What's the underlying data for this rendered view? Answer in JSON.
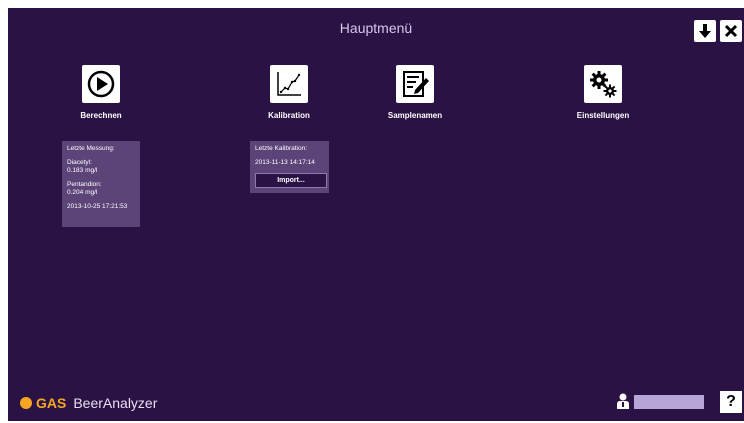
{
  "header": {
    "title": "Hauptmenü",
    "download_icon": "download-arrow-icon",
    "close_icon": "close-icon"
  },
  "tiles": [
    {
      "label": "Berechnen",
      "icon": "play-icon"
    },
    {
      "label": "Kalibration",
      "icon": "chart-line-icon"
    },
    {
      "label": "Samplenamen",
      "icon": "edit-document-icon"
    },
    {
      "label": "Einstellungen",
      "icon": "gears-icon"
    }
  ],
  "last_measurement": {
    "heading": "Letzte Messung:",
    "diacetyl_label": "Diacetyl:",
    "diacetyl_value": "0.183 mg/l",
    "pentandion_label": "Pentandion:",
    "pentandion_value": "0.204 mg/l",
    "timestamp": "2013-10-25 17:21:53"
  },
  "last_calibration": {
    "heading": "Letzte Kalibration:",
    "timestamp": "2013-11-13 14:17:14",
    "import_label": "Import..."
  },
  "footer": {
    "logo_gas": "GAS",
    "app_name": "BeerAnalyzer",
    "user_value": "",
    "help_label": "?"
  },
  "colors": {
    "background": "#2b1245",
    "box": "#5c4479",
    "accent": "#f6a623",
    "user_field": "#b6a5d6"
  }
}
